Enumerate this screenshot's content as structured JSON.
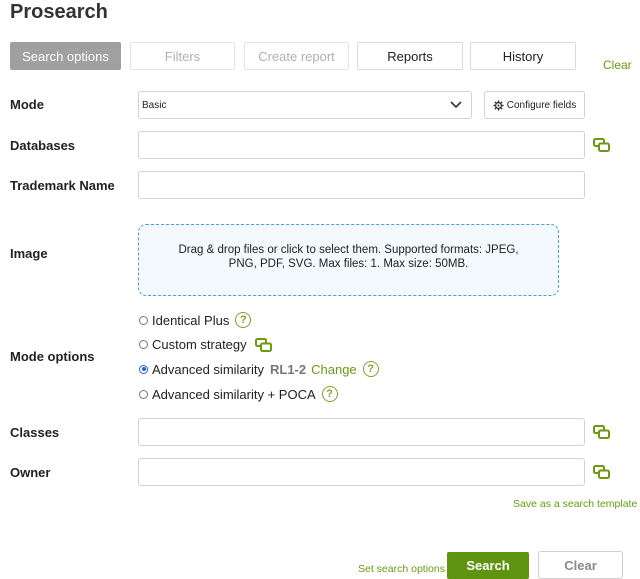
{
  "app": {
    "title": "Prosearch"
  },
  "tabs": [
    {
      "label": "Search options",
      "state": "active"
    },
    {
      "label": "Filters",
      "state": "disabled"
    },
    {
      "label": "Create report",
      "state": "disabled"
    },
    {
      "label": "Reports",
      "state": "normal"
    },
    {
      "label": "History",
      "state": "normal"
    }
  ],
  "header": {
    "clear_link": "Clear"
  },
  "form": {
    "mode": {
      "label": "Mode",
      "value": "Basic",
      "configure_label": "Configure fields"
    },
    "databases": {
      "label": "Databases",
      "value": ""
    },
    "trademark_name": {
      "label": "Trademark Name",
      "value": ""
    },
    "image": {
      "label": "Image",
      "dropzone_line1": "Drag & drop files or click to select them. Supported formats: JPEG,",
      "dropzone_line2": "PNG, PDF, SVG. Max files: 1. Max size: 50MB."
    },
    "mode_options": {
      "label": "Mode options",
      "options": [
        {
          "label": "Identical Plus",
          "checked": false
        },
        {
          "label": "Custom strategy",
          "checked": false
        },
        {
          "label": "Advanced similarity",
          "tag": "RL1-2",
          "change": "Change",
          "checked": true
        },
        {
          "label": "Advanced similarity + POCA",
          "checked": false
        }
      ]
    },
    "classes": {
      "label": "Classes",
      "value": ""
    },
    "owner": {
      "label": "Owner",
      "value": ""
    }
  },
  "footer": {
    "save_template": "Save as a search template",
    "set_options": "Set search options",
    "search_button": "Search",
    "clear_button": "Clear"
  },
  "icons": {
    "copy": "copy-window-icon",
    "help": "question-circle-icon",
    "gear": "gear-icon",
    "chevron": "chevron-down-icon"
  },
  "colors": {
    "accent_green": "#5f9410",
    "link_green": "#6a9a12",
    "dropzone_border": "#4a9fd8",
    "radio_selected": "#1e64c8",
    "active_tab": "#a0a0a0"
  }
}
